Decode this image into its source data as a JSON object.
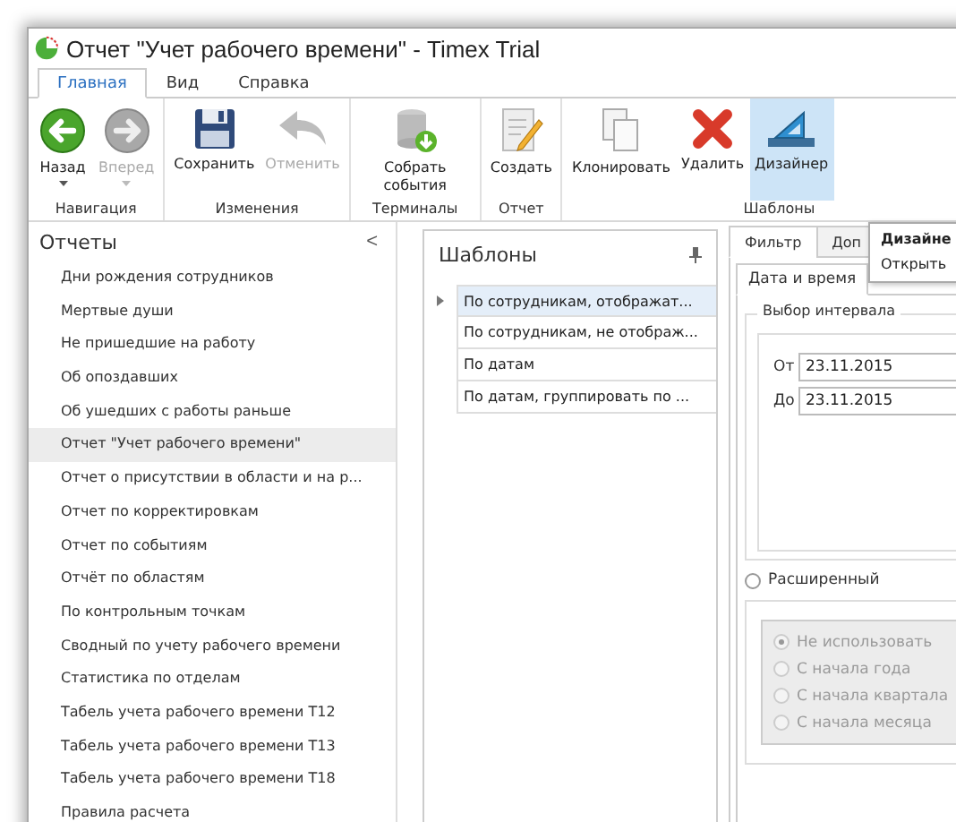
{
  "window": {
    "title": "Отчет \"Учет рабочего времени\" - Timex Trial"
  },
  "ribbon_tabs": [
    {
      "label": "Главная",
      "selected": true
    },
    {
      "label": "Вид",
      "selected": false
    },
    {
      "label": "Справка",
      "selected": false
    }
  ],
  "ribbon_groups": [
    {
      "label": "Навигация",
      "buttons": [
        {
          "label": "Назад",
          "disabled": false,
          "dropdown": true,
          "selected": false
        },
        {
          "label": "Вперед",
          "disabled": true,
          "dropdown": true,
          "selected": false
        }
      ]
    },
    {
      "label": "Изменения",
      "buttons": [
        {
          "label": "Сохранить",
          "disabled": false,
          "dropdown": false,
          "selected": false
        },
        {
          "label": "Отменить",
          "disabled": true,
          "dropdown": false,
          "selected": false
        }
      ]
    },
    {
      "label": "Терминалы",
      "buttons": [
        {
          "label": "Собрать события",
          "disabled": false,
          "dropdown": false,
          "selected": false
        }
      ]
    },
    {
      "label": "Отчет",
      "buttons": [
        {
          "label": "Создать",
          "disabled": false,
          "dropdown": false,
          "selected": false
        }
      ]
    },
    {
      "label": "Шаблоны",
      "buttons": [
        {
          "label": "Клонировать",
          "disabled": false,
          "dropdown": false,
          "selected": false
        },
        {
          "label": "Удалить",
          "disabled": false,
          "dropdown": false,
          "selected": false
        },
        {
          "label": "Дизайнер",
          "disabled": false,
          "dropdown": false,
          "selected": true
        }
      ]
    }
  ],
  "reports_panel": {
    "title": "Отчеты",
    "collapse": "<",
    "items": [
      {
        "label": "Дни рождения сотрудников",
        "selected": false
      },
      {
        "label": "Мертвые души",
        "selected": false
      },
      {
        "label": "Не пришедшие на работу",
        "selected": false
      },
      {
        "label": "Об опоздавших",
        "selected": false
      },
      {
        "label": "Об ушедших с работы раньше",
        "selected": false
      },
      {
        "label": "Отчет \"Учет рабочего времени\"",
        "selected": true
      },
      {
        "label": "Отчет о присутствии в области и на р...",
        "selected": false
      },
      {
        "label": "Отчет по корректировкам",
        "selected": false
      },
      {
        "label": "Отчет по событиям",
        "selected": false
      },
      {
        "label": "Отчёт по областям",
        "selected": false
      },
      {
        "label": "По контрольным точкам",
        "selected": false
      },
      {
        "label": "Сводный по учету рабочего времени",
        "selected": false
      },
      {
        "label": "Статистика по отделам",
        "selected": false
      },
      {
        "label": "Табель учета рабочего времени Т12",
        "selected": false
      },
      {
        "label": "Табель учета рабочего времени Т13",
        "selected": false
      },
      {
        "label": "Табель учета рабочего времени Т18",
        "selected": false
      },
      {
        "label": "Правила расчета",
        "selected": false
      }
    ]
  },
  "templates_panel": {
    "title": "Шаблоны",
    "rows": [
      {
        "label": "По сотрудникам, отображат...",
        "selected": true
      },
      {
        "label": "По сотрудникам, не отображ...",
        "selected": false
      },
      {
        "label": "По датам",
        "selected": false
      },
      {
        "label": "По датам, группировать по ...",
        "selected": false
      }
    ]
  },
  "filter_tabs": [
    {
      "label": "Фильтр",
      "selected": true
    },
    {
      "label": "Доп",
      "selected": false
    }
  ],
  "filter_subtabs": [
    {
      "label": "Дата и время",
      "selected": true
    }
  ],
  "interval": {
    "title": "Выбор интервала",
    "from_label": "От",
    "from": "23.11.2015",
    "to_label": "До",
    "to": "23.11.2015"
  },
  "extended": {
    "label": "Расширенный",
    "selected": false,
    "options": [
      {
        "label": "Не использовать",
        "selected": true,
        "disabled": true
      },
      {
        "label": "С начала года",
        "selected": false,
        "disabled": true
      },
      {
        "label": "С начала квартала",
        "selected": false,
        "disabled": true
      },
      {
        "label": "С начала месяца",
        "selected": false,
        "disabled": true
      }
    ]
  },
  "popup_menu": {
    "items": [
      {
        "label": "Дизайне",
        "kind": "header"
      },
      {
        "label": "Открыть",
        "kind": "item"
      }
    ]
  }
}
